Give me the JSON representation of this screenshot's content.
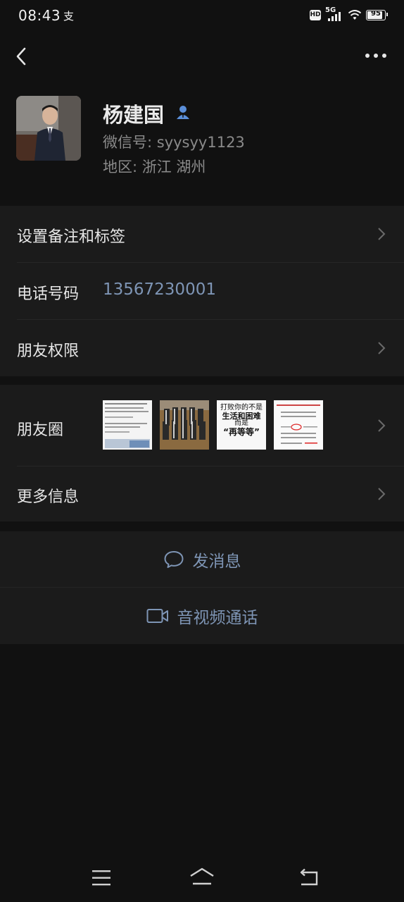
{
  "status_bar": {
    "time": "08:43",
    "app_indicator": "支",
    "hd": "HD",
    "network": "5G",
    "battery": "95",
    "battery_level": 0.95
  },
  "header": {
    "back_icon": "chevron-left-icon",
    "more_icon": "ellipsis-icon"
  },
  "profile": {
    "name": "杨建国",
    "wechat_id": "微信号: syysyy1123",
    "region": "地区: 浙江  湖州",
    "avatar_icon": "avatar-photo"
  },
  "menu": {
    "remark_tags": "设置备注和标签",
    "phone_label": "电话号码",
    "phone_value": "13567230001",
    "permissions": "朋友权限",
    "moments": "朋友圈",
    "more_info": "更多信息"
  },
  "moments_thumbs": {
    "thumb3": {
      "line1": "打败你的不是",
      "line2": "生活和困难",
      "line3": "而是",
      "line4": "“再等等”"
    }
  },
  "actions": {
    "message": "发消息",
    "call": "音视频通话"
  },
  "colors": {
    "background": "#111111",
    "cell": "#1b1b1b",
    "link": "#7e95b5",
    "verified": "#5b8fd9"
  }
}
